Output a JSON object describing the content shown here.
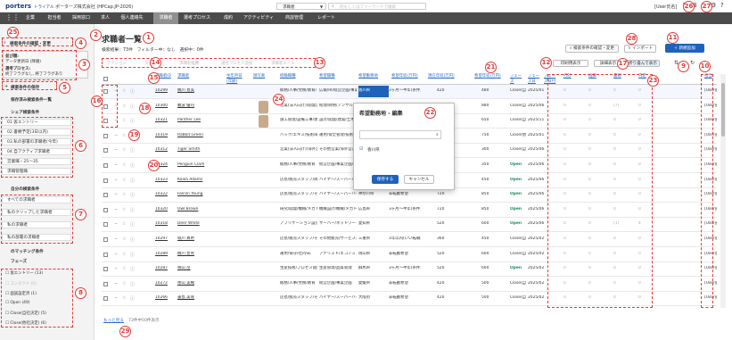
{
  "header": {
    "logo": "porters",
    "trial": "トライアル",
    "company": "ポーターズ株式会社 (HPCap.JP-2026)",
    "dropdown": "求職者",
    "search_placeholder": "何もしくはフリーワードで検索",
    "user": "[User氏名]"
  },
  "nav": {
    "items": [
      "企業",
      "担当者",
      "採用窓口",
      "求人",
      "個人連絡先",
      "求職者",
      "選考プロセス",
      "成約",
      "アクティビティ",
      "商談管理",
      "レポート"
    ],
    "active": "求職者"
  },
  "sidebar": {
    "search_change": "検索条件の確認・変更",
    "conditions_title": "並び順:",
    "conditions_sort": "データ更新日 (降順)",
    "conditions_process_title": "選考プロセス:",
    "conditions_process": "終了フラグなし, 終了フラグあり",
    "save_conditions": "検索条件の保存",
    "saved_list": "保存済み検索条件一覧",
    "shared_title": "シェア検索条件",
    "shared_items": [
      "01.仮エントリー",
      "02.書類予定(3日以内)",
      "03.私の部署の求職者(今年)",
      "04.自アクティブ求職者",
      "営業職・25〜35",
      "求職管理職"
    ],
    "own_title": "自分の検索条件",
    "own_items": [
      "すべての求職者",
      "私のクリップした求職者",
      "私の求職者",
      "私の部署の求職者"
    ],
    "matching_title": "のマッチング条件",
    "phase_title": "フェーズ",
    "phase_items": [
      "仮エントリー (13)",
      "コンタクト (0)",
      "面談設定済 (1)",
      "Open (49)",
      "Close(自社決定) (5)",
      "Close(他社決定) (6)"
    ]
  },
  "main": {
    "title": "求職者一覧",
    "summary": "検索結果：73件　フィルター中：なし　選択中：0件",
    "toolbar_disabled": [
      "アクション",
      "タグ付け",
      "求職者推薦",
      "選考プロセス追加",
      "求職者メール"
    ],
    "search_change": "検索条件の確認・変更",
    "import": "インポート",
    "new": "+ 新規追加",
    "print": "印刷用表示",
    "detail": "詳細表示",
    "fold": "折り畳んで表示",
    "more": "もっと見る",
    "more_count": "73件中50件表示",
    "columns": [
      "求職者ID",
      "求職者",
      "生年月日(年齢)",
      "顔写真",
      "経験職種",
      "希望職種",
      "希望勤務地",
      "希望年収(万円)",
      "現在年収(万円)",
      "希望年収(万円)",
      "フェーズ",
      "フェーズ日",
      "フェーズ日付",
      "打診",
      "推薦",
      "書類",
      "内定",
      "担当"
    ],
    "rows": [
      {
        "id": "10299",
        "name": "橋川 直美",
        "bd": "35",
        "exp": "総務/人事/労務/教育/",
        "wish": "広報/IR/経営企画/事業企画",
        "loc": "香川県",
        "shift": "3ヶ月〜半年(条件)",
        "cur": "420",
        "w2": "480",
        "phase": "Close(自社決定)",
        "date": "2025/01/16",
        "c1": "0",
        "c2": "0",
        "c3": "0",
        "c4": "0",
        "user": "[User部署]"
      },
      {
        "id": "10300",
        "name": "難波 優司",
        "bd": "",
        "exp": "営業(法人向け)/開発営業/",
        "wish": "経理/財務/アンサルタント",
        "loc": "",
        "shift": "",
        "cur": "780",
        "w2": "880",
        "phase": "Close(自社決定)",
        "date": "2025/06/12",
        "c1": "0",
        "c2": "0",
        "c3": "(7)",
        "c4": "0",
        "user": "[User部署]"
      },
      {
        "id": "10321",
        "name": "Panther Lee",
        "bd": "",
        "exp": "施工管理/設備工事/建築/",
        "wish": "設計/開発/建築/土木/",
        "loc": "",
        "shift": "",
        "cur": "580",
        "w2": "650",
        "phase": "Close(自社決定)",
        "date": "2025/11/",
        "c1": "0",
        "c2": "0",
        "c3": "0",
        "c4": "0",
        "user": "[User部署]"
      },
      {
        "id": "10319",
        "name": "Rabbit Green",
        "bd": "",
        "exp": "バック/エキス/技術/研修",
        "wish": "運用/保全管理/技術",
        "loc": "",
        "shift": "",
        "cur": "680",
        "w2": "750",
        "phase": "Close(他社決定)",
        "date": "2025/01/",
        "c1": "0",
        "c2": "0",
        "c3": "0",
        "c4": "0",
        "user": "[User部署]"
      },
      {
        "id": "10312",
        "name": "Tiger Smith",
        "bd": "",
        "exp": "営業(法人向け)/海外営業",
        "wish": "その他営業/海外営業/",
        "loc": "",
        "shift": "",
        "cur": "250",
        "w2": "300",
        "phase": "Close(自社決定)",
        "date": "2025/06/",
        "c1": "0",
        "c2": "0",
        "c3": "0",
        "c4": "0",
        "user": "[User部署]"
      },
      {
        "id": "10324",
        "name": "Penguin Clark",
        "bd": "",
        "exp": "総務/人事/労務/教育",
        "wish": "経営企画/事業企画/広報",
        "loc": "",
        "shift": "",
        "cur": "280",
        "w2": "350",
        "phase": "Open",
        "date": "2025/06/",
        "c1": "0",
        "c2": "0",
        "c3": "0",
        "c4": "0",
        "user": "[User部署]"
      },
      {
        "id": "10323",
        "name": "Koala Adams",
        "bd": "",
        "exp": "店長/販売スタッフ/商品管",
        "wish": "バイヤー/スーパーバイ",
        "loc": "",
        "shift": "",
        "cur": "360",
        "w2": "450",
        "phase": "Open",
        "date": "2025/06/",
        "c1": "0",
        "c2": "0",
        "c3": "0",
        "c4": "0",
        "user": "[User部署]"
      },
      {
        "id": "10322",
        "name": "Falcon Young",
        "bd": "",
        "exp": "店長/販売スタッフ/その他",
        "wish": "バイヤー/スーパーバイ",
        "loc": "神奈川県",
        "shift": "非転勤希望",
        "cur": "720",
        "w2": "850",
        "phase": "Open",
        "date": "2025/06/",
        "c1": "0",
        "c2": "0",
        "c3": "0",
        "c4": "0",
        "user": "[User部署]"
      },
      {
        "id": "10320",
        "name": "Owl Brown",
        "bd": "",
        "exp": "研究/開発/機械/メカトロ",
        "wish": "機械設計/機械/メカトロ",
        "loc": "広島県",
        "shift": "3ヶ月〜半年(条件)",
        "cur": "720",
        "w2": "850",
        "phase": "Open",
        "date": "2025/06/",
        "c1": "0",
        "c2": "0",
        "c3": "0",
        "c4": "0",
        "user": "[User部署]"
      },
      {
        "id": "10318",
        "name": "Deer White",
        "bd": "",
        "exp": "アプリケーション設計/",
        "wish": "サーバー/ネットワーク",
        "loc": "愛知県",
        "shift": "",
        "cur": "520",
        "w2": "600",
        "phase": "Open",
        "date": "2025/06/",
        "c1": "0",
        "c2": "0",
        "c3": "(1)",
        "c4": "4",
        "user": "[User部署]"
      },
      {
        "id": "10297",
        "name": "堀川 真希",
        "bd": "",
        "exp": "店長/販売スタッフ/その他",
        "wish": "その他販売/サービス系",
        "loc": "三重県",
        "shift": "1年以内(いい転職先があれば)",
        "cur": "360",
        "w2": "450",
        "phase": "Close(自社決定)",
        "date": "2025/02/10",
        "c1": "0",
        "c2": "0",
        "c3": "0",
        "c4": "0",
        "user": "[User部署]"
      },
      {
        "id": "10289",
        "name": "橋川 晋男",
        "bd": "",
        "exp": "運用/保守/社内SE",
        "wish": "アナリスト/エコノミスト",
        "loc": "岡山県",
        "shift": "非転勤希望",
        "cur": "520",
        "w2": "600",
        "phase": "Close(自社決定)",
        "date": "2025/02/01",
        "c1": "0",
        "c2": "0",
        "c3": "0",
        "c4": "0",
        "user": "[User部署]"
      },
      {
        "id": "10287",
        "name": "殊山 岳",
        "bd": "",
        "exp": "生産技術/プロセス開発/",
        "wish": "生産管理/品質管理",
        "loc": "群馬県",
        "shift": "3ヶ月〜半年(条件)",
        "cur": "520",
        "w2": "600",
        "phase": "Open",
        "date": "2025/02/",
        "c1": "0",
        "c2": "0",
        "c3": "0",
        "c4": "0",
        "user": "[User部署]"
      },
      {
        "id": "10272",
        "name": "斎山 美緒",
        "bd": "",
        "exp": "総務/人事/労務/教育",
        "wish": "経営企画/事業企画",
        "loc": "愛媛県",
        "shift": "非転勤希望",
        "cur": "420",
        "w2": "500",
        "phase": "Close(自社決定)",
        "date": "2025/02/",
        "c1": "0",
        "c2": "0",
        "c3": "0",
        "c4": "0",
        "user": "[User部署]"
      },
      {
        "id": "10266",
        "name": "書島 美咲",
        "bd": "",
        "exp": "店長/販売スタッフ/その他",
        "wish": "バイヤー/スーパーバイ",
        "loc": "大阪府",
        "shift": "非転勤希望",
        "cur": "420",
        "w2": "500",
        "phase": "Close(自社決定)",
        "date": "2025/02/",
        "c1": "0",
        "c2": "0",
        "c3": "0",
        "c4": "0",
        "user": "[User部署]"
      }
    ]
  },
  "popup": {
    "title": "希望勤務地 - 編集",
    "loc_head": "香川県",
    "option": "香川県",
    "save": "保存する",
    "cancel": "キャンセル"
  },
  "markers": [
    "1",
    "2",
    "3",
    "4",
    "5",
    "6",
    "7",
    "8",
    "9",
    "10",
    "11",
    "12",
    "13",
    "14",
    "15",
    "16",
    "17",
    "18",
    "19",
    "20",
    "21",
    "22",
    "23",
    "24",
    "25",
    "26",
    "27",
    "28",
    "29"
  ]
}
